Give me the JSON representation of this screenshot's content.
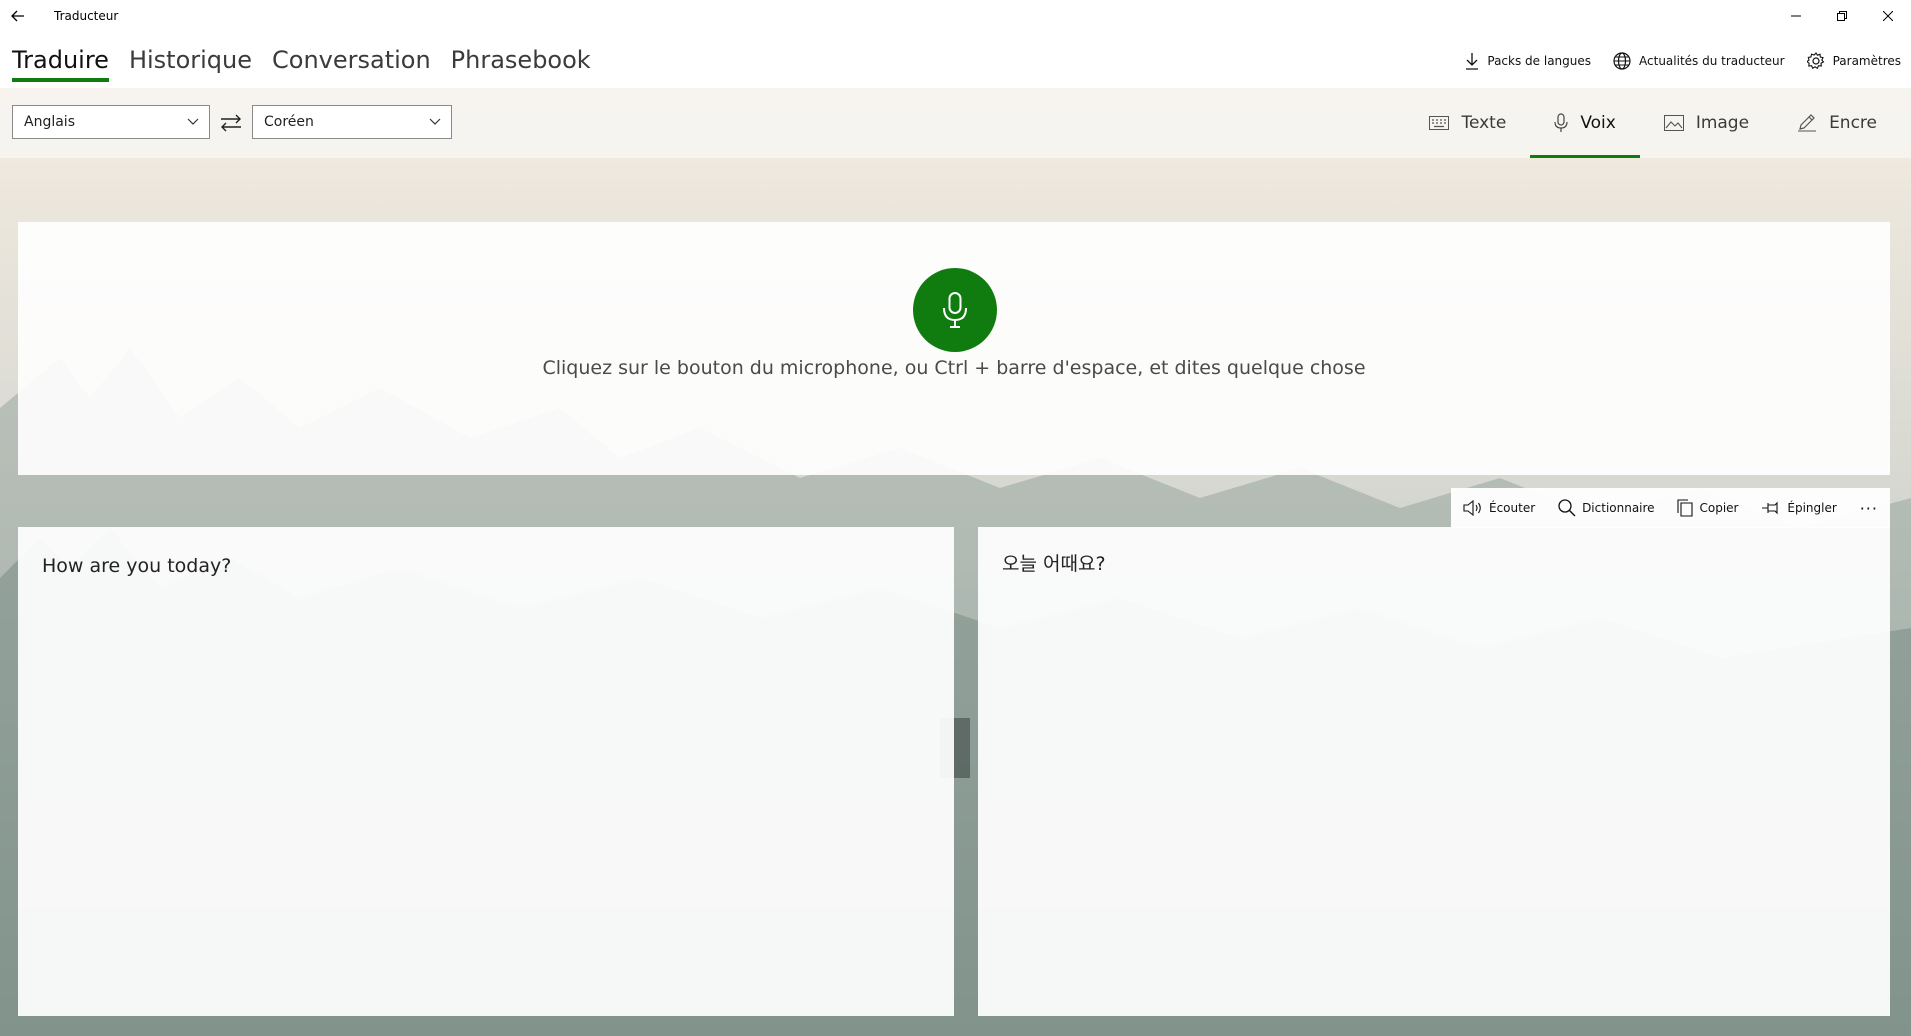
{
  "window": {
    "title": "Traducteur"
  },
  "nav": {
    "tabs": [
      {
        "label": "Traduire",
        "active": true
      },
      {
        "label": "Historique",
        "active": false
      },
      {
        "label": "Conversation",
        "active": false
      },
      {
        "label": "Phrasebook",
        "active": false
      }
    ],
    "actions": [
      {
        "label": "Packs de langues",
        "icon": "download-icon"
      },
      {
        "label": "Actualités du traducteur",
        "icon": "globe-icon"
      },
      {
        "label": "Paramètres",
        "icon": "gear-icon"
      }
    ]
  },
  "languages": {
    "source": "Anglais",
    "target": "Coréen"
  },
  "modes": [
    {
      "label": "Texte",
      "icon": "keyboard-icon",
      "active": false
    },
    {
      "label": "Voix",
      "icon": "microphone-icon",
      "active": true
    },
    {
      "label": "Image",
      "icon": "image-icon",
      "active": false
    },
    {
      "label": "Encre",
      "icon": "pen-icon",
      "active": false
    }
  ],
  "voice": {
    "hint": "Cliquez sur le bouton du microphone, ou Ctrl + barre d'espace, et dites quelque chose"
  },
  "output_toolbar": {
    "listen": "Écouter",
    "dictionary": "Dictionnaire",
    "copy": "Copier",
    "pin": "Épingler",
    "more": "···"
  },
  "translation": {
    "source_text": "How are you today?",
    "target_text": "오늘 어때요?"
  },
  "colors": {
    "accent": "#107c10"
  }
}
